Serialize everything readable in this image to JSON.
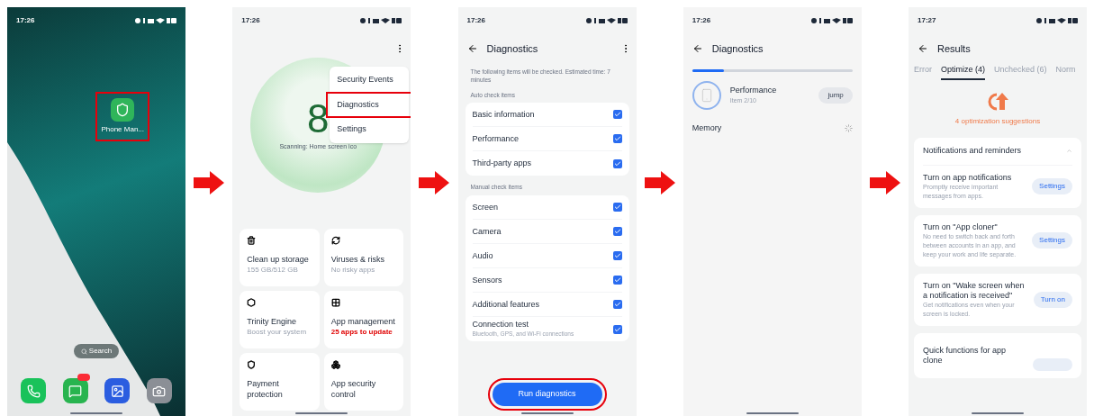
{
  "screens": [
    {
      "kind": "home",
      "time": "17:26",
      "app": {
        "label": "Phone Man...",
        "highlighted": true
      },
      "search": "Search"
    },
    {
      "kind": "manager",
      "time": "17:26",
      "score": "8",
      "scanning": "Scanning: Home screen ico",
      "menu": [
        {
          "label": "Security Events",
          "highlighted": false
        },
        {
          "label": "Diagnostics",
          "highlighted": true
        },
        {
          "label": "Settings",
          "highlighted": false
        }
      ],
      "cards": [
        {
          "title": "Clean up storage",
          "subtitle": "155 GB/512 GB",
          "alert": false
        },
        {
          "title": "Viruses & risks",
          "subtitle": "No risky apps",
          "alert": false
        },
        {
          "title": "Trinity Engine",
          "subtitle": "Boost your system",
          "alert": false
        },
        {
          "title": "App management",
          "subtitle": "25 apps to update",
          "alert": true
        },
        {
          "title": "Payment protection"
        },
        {
          "title": "App security control"
        }
      ]
    },
    {
      "kind": "diagnostics",
      "time": "17:26",
      "title": "Diagnostics",
      "intro": "The following items will be checked. Estimated time: 7 minutes",
      "sections": [
        {
          "heading": "Auto check items",
          "items": [
            {
              "label": "Basic information",
              "checked": true
            },
            {
              "label": "Performance",
              "checked": true
            },
            {
              "label": "Third-party apps",
              "checked": true
            }
          ]
        },
        {
          "heading": "Manual check items",
          "items": [
            {
              "label": "Screen",
              "checked": true
            },
            {
              "label": "Camera",
              "checked": true
            },
            {
              "label": "Audio",
              "checked": true
            },
            {
              "label": "Sensors",
              "checked": true
            },
            {
              "label": "Additional features",
              "checked": true
            },
            {
              "label": "Connection test",
              "sublabel": "Bluetooth, GPS, and Wi-Fi connections",
              "checked": true
            }
          ]
        }
      ],
      "button": {
        "label": "Run diagnostics",
        "highlighted": true
      }
    },
    {
      "kind": "progress",
      "time": "17:26",
      "title": "Diagnostics",
      "level": 0.2,
      "current": {
        "title": "Performance",
        "subtitle": "Item 2/10"
      },
      "jump": "jump",
      "items": [
        "Memory"
      ]
    },
    {
      "kind": "results",
      "time": "17:27",
      "title": "Results",
      "tabs": [
        {
          "label": "Error",
          "selected": false
        },
        {
          "label": "Optimize (4)",
          "selected": true
        },
        {
          "label": "Unchecked (6)",
          "selected": false
        },
        {
          "label": "Norm",
          "selected": false
        }
      ],
      "summary": "4 optimization suggestions",
      "group": {
        "title": "Notifications and reminders",
        "expanded": true
      },
      "suggestions": [
        {
          "title": "Turn on app notifications",
          "description": "Promptly receive important messages from apps.",
          "action": "Settings"
        },
        {
          "title": "Turn on \"App cloner\"",
          "description": "No need to switch back and forth between accounts in an app, and keep your work and life separate.",
          "action": "Settings"
        },
        {
          "title": "Turn on \"Wake screen when a notification is received\"",
          "description": "Get notifications even when your screen is locked.",
          "action": "Turn on"
        },
        {
          "title": "Quick functions for app clone"
        }
      ]
    }
  ]
}
